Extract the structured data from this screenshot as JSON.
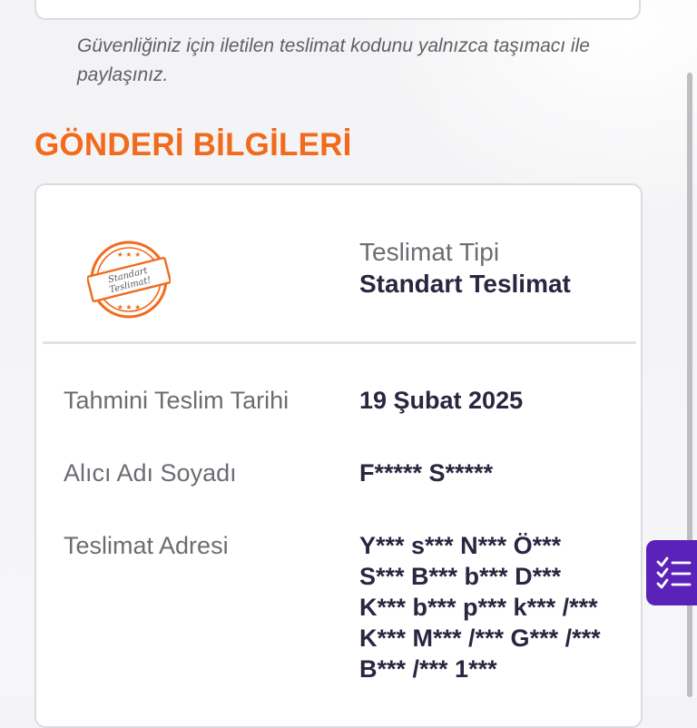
{
  "security_note": "Güvenliğiniz için iletilen teslimat kodunu yalnızca taşımacı ile paylaşınız.",
  "section_title": "GÖNDERİ BİLGİLERİ",
  "delivery_type": {
    "label": "Teslimat Tipi",
    "value": "Standart Teslimat",
    "stamp_line1": "Standart",
    "stamp_line2": "Teslimat!"
  },
  "details": {
    "estimated_date_label": "Tahmini Teslim Tarihi",
    "estimated_date_value": "19 Şubat 2025",
    "recipient_label": "Alıcı Adı Soyadı",
    "recipient_value": "F***** S*****",
    "address_label": "Teslimat Adresi",
    "address_value": "Y*** s*** N*** Ö*** S*** B*** b*** D*** K*** b*** p*** k*** /*** K*** M*** /*** G*** /*** B*** /*** 1***"
  },
  "colors": {
    "accent_orange": "#f26a1b",
    "brand_purple": "#5a22b8",
    "text_dark": "#2b2540",
    "text_muted": "#6c6c73"
  },
  "icons": {
    "stamp": "standart-teslimat-stamp-icon",
    "fab": "checklist-icon"
  }
}
